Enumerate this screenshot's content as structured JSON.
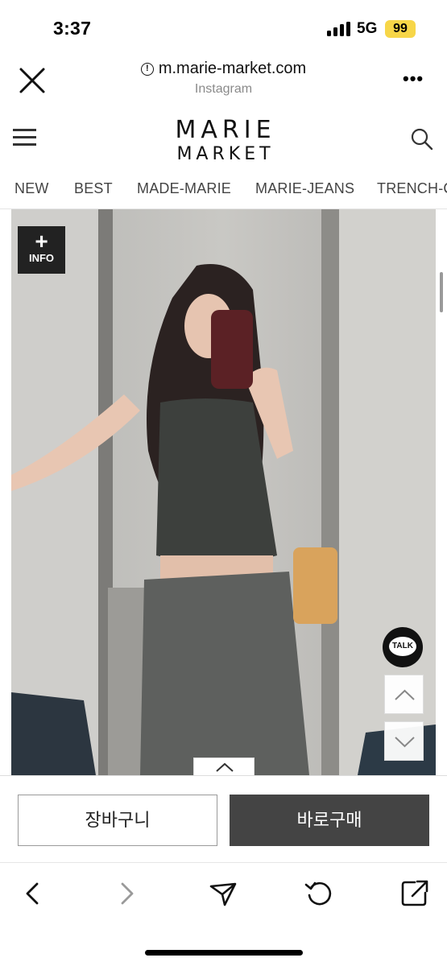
{
  "status_bar": {
    "time": "3:37",
    "network": "5G",
    "battery": "99"
  },
  "browser": {
    "url": "m.marie-market.com",
    "source": "Instagram",
    "more_label": "•••"
  },
  "site": {
    "logo_top": "MARIE",
    "logo_bottom": "MARKET",
    "nav": [
      "NEW",
      "BEST",
      "MADE-MARIE",
      "MARIE-JEANS",
      "TRENCH-C"
    ]
  },
  "product": {
    "info_plus": "+",
    "info_label": "INFO",
    "talk_label": "TALK"
  },
  "purchase": {
    "cart_label": "장바구니",
    "buy_label": "바로구매"
  },
  "colors": {
    "battery": "#f7d648",
    "buy_button": "#444444",
    "talk_button": "#111111"
  },
  "icons": [
    "close-icon",
    "info-icon",
    "more-icon",
    "menu-icon",
    "search-icon",
    "chevron-up-icon",
    "chevron-down-icon",
    "back-icon",
    "forward-icon",
    "share-icon",
    "reload-icon",
    "open-external-icon"
  ]
}
